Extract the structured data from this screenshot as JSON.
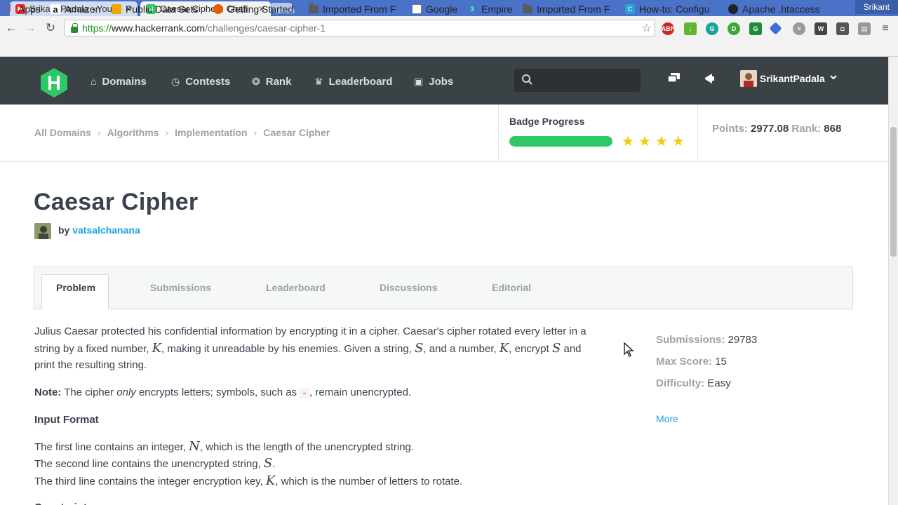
{
  "browser": {
    "tabs": [
      {
        "title": "Srikant Padala - You",
        "favicon_color": "#e52d27",
        "active": false
      },
      {
        "title": "Caesar Cipher : Chall",
        "favicon_color": "#2ec866",
        "active": true
      }
    ],
    "window_user": "Srikant",
    "url": {
      "scheme": "https://",
      "host": "www.hackerrank.com",
      "path": "/challenges/caesar-cipher-1"
    },
    "bookmarks": [
      {
        "label": "Apps",
        "icon": "apps-grid-icon"
      },
      {
        "label": "Amazon",
        "icon": "amazon-icon"
      },
      {
        "label": "Public Data Sets",
        "icon": "folder-icon"
      },
      {
        "label": "Getting Started",
        "icon": "firefox-icon"
      },
      {
        "label": "Imported From F",
        "icon": "folder-icon"
      },
      {
        "label": "Google",
        "icon": "page-icon"
      },
      {
        "label": "Empire",
        "icon": "empire-icon"
      },
      {
        "label": "Imported From F",
        "icon": "folder-icon"
      },
      {
        "label": "How-to: Configu",
        "icon": "site-icon"
      },
      {
        "label": "Apache .htaccess",
        "icon": "apache-icon"
      }
    ]
  },
  "header": {
    "nav": [
      {
        "label": "Domains",
        "icon": "home-icon"
      },
      {
        "label": "Contests",
        "icon": "clock-icon"
      },
      {
        "label": "Rank",
        "icon": "medal-icon"
      },
      {
        "label": "Leaderboard",
        "icon": "trophy-icon"
      },
      {
        "label": "Jobs",
        "icon": "briefcase-icon"
      }
    ],
    "search_placeholder": "",
    "username": "SrikantPadala"
  },
  "breadcrumb": [
    "All Domains",
    "Algorithms",
    "Implementation",
    "Caesar Cipher"
  ],
  "badge": {
    "title": "Badge Progress",
    "progress_fraction": 1.0,
    "stars": 4
  },
  "points": {
    "points_label": "Points:",
    "points_value": "2977.08",
    "rank_label": "Rank:",
    "rank_value": "868"
  },
  "challenge": {
    "title": "Caesar Cipher",
    "by_label": "by",
    "author": "vatsalchanana",
    "tabs": [
      "Problem",
      "Submissions",
      "Leaderboard",
      "Discussions",
      "Editorial"
    ],
    "active_tab": "Problem"
  },
  "problem": {
    "intro_1": "Julius Caesar protected his confidential information by encrypting it in a cipher. Caesar's cipher rotated every letter in a string by a fixed number, ",
    "var_k": "K",
    "intro_2": ", making it unreadable by his enemies. Given a string, ",
    "var_s": "S",
    "intro_3": ", and a number, ",
    "intro_4": ", encrypt ",
    "intro_5": " and print the resulting string.",
    "note_label": "Note:",
    "note_1": " The cipher ",
    "note_only": "only",
    "note_2": " encrypts letters; symbols, such as ",
    "note_symbol": "-",
    "note_3": ", remain unencrypted.",
    "input_format_heading": "Input Format",
    "line1_a": "The first line contains an integer, ",
    "var_n": "N",
    "line1_b": ", which is the length of the unencrypted string.",
    "line2_a": "The second line contains the unencrypted string, ",
    "line2_b": ".",
    "line3_a": "The third line contains the integer encryption key, ",
    "line3_b": ", which is the number of letters to rotate.",
    "constraints_heading": "Constraints"
  },
  "stats": {
    "submissions_label": "Submissions:",
    "submissions_value": "29783",
    "max_score_label": "Max Score:",
    "max_score_value": "15",
    "difficulty_label": "Difficulty:",
    "difficulty_value": "Easy",
    "more_label": "More"
  },
  "colors": {
    "accent_green": "#2ec866",
    "header_bg": "#3b4246",
    "link_blue": "#1ba2e3",
    "star_yellow": "#f2cc0c"
  }
}
